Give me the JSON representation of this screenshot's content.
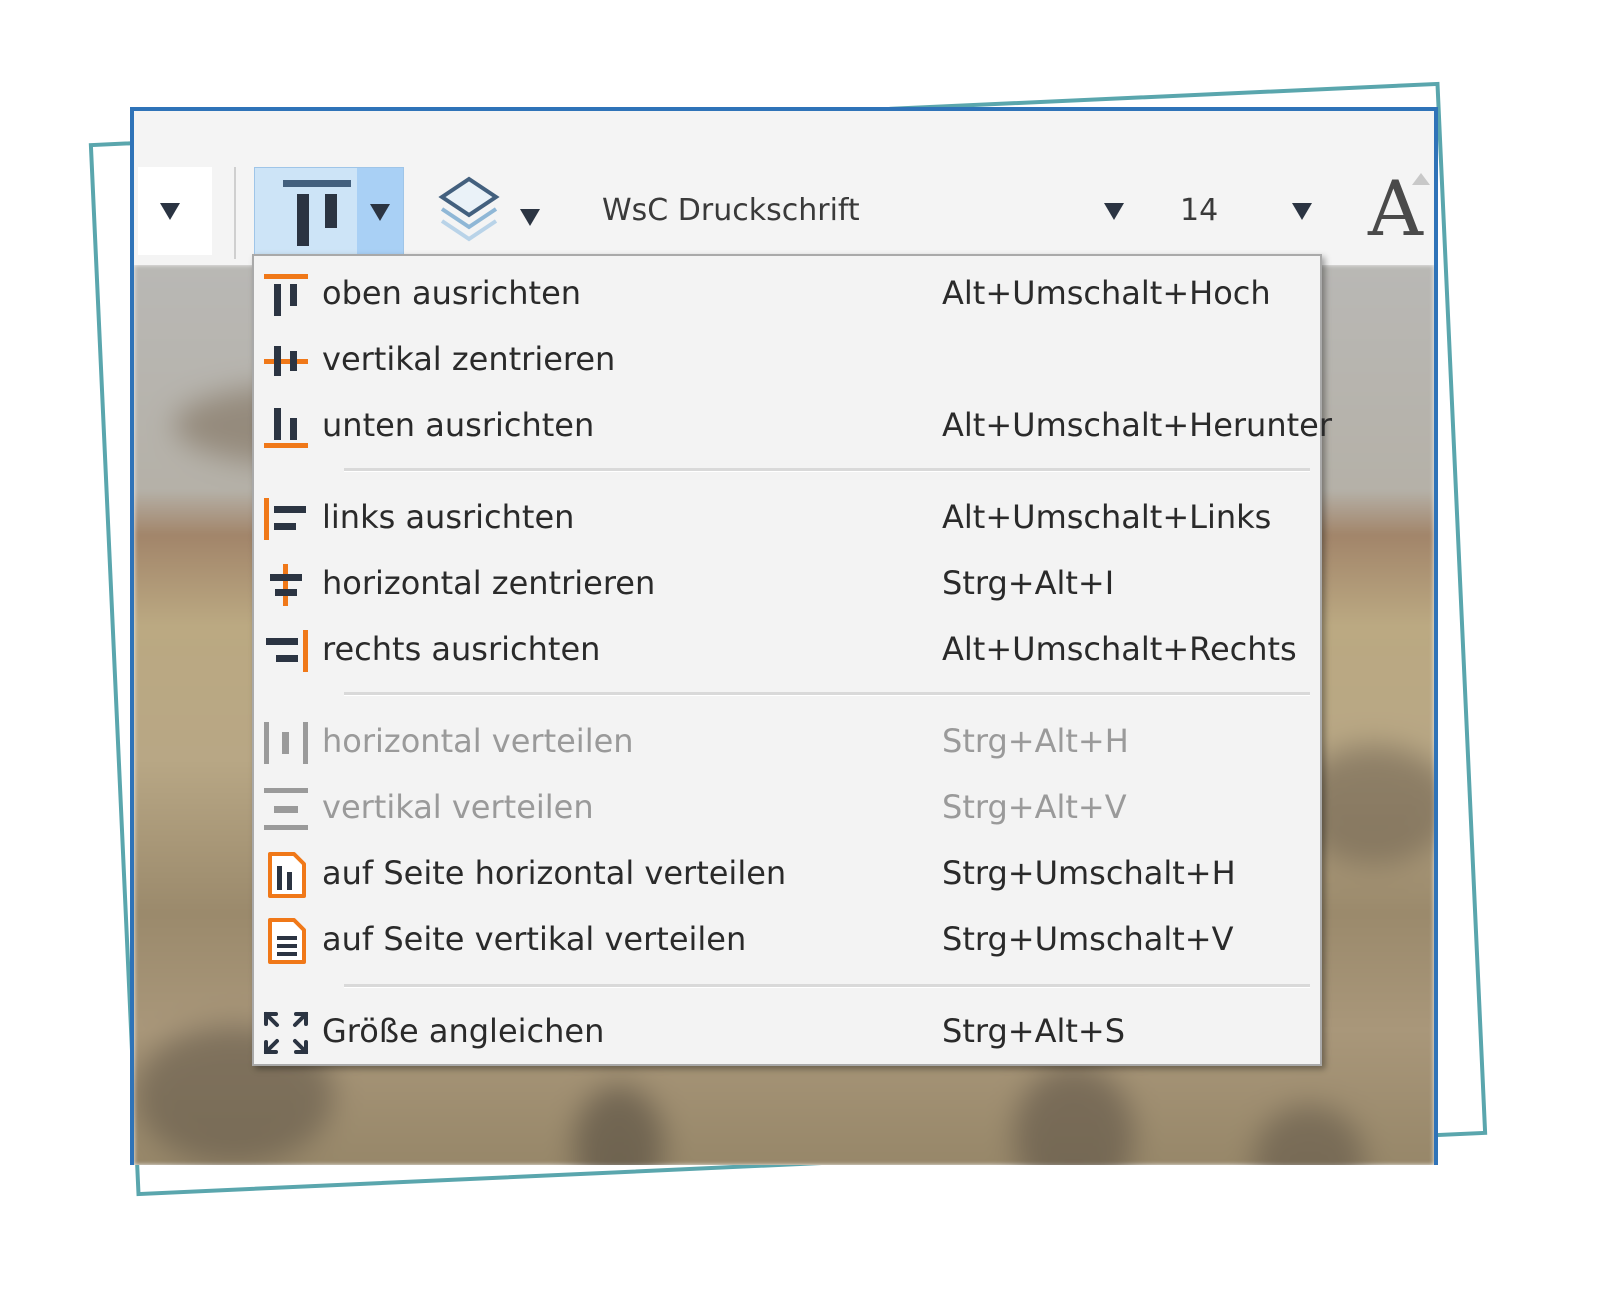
{
  "toolbar": {
    "font_name": "WsC Druckschrift",
    "font_size": "14",
    "font_glyph": "A",
    "icons": [
      "dropdown-arrow-icon",
      "align-top-icon",
      "layers-icon",
      "font-style-icon"
    ]
  },
  "colors": {
    "accent_orange": "#f07818",
    "icon_dark": "#2b3442",
    "frame_teal": "#5aa6ad",
    "window_border": "#2f73b8",
    "split_highlight": "#a9d0f5"
  },
  "menu": {
    "items": [
      {
        "label": "oben ausrichten",
        "shortcut": "Alt+Umschalt+Hoch",
        "enabled": true,
        "icon": "align-top-icon"
      },
      {
        "label": "vertikal zentrieren",
        "shortcut": "",
        "enabled": true,
        "icon": "align-vertical-center-icon"
      },
      {
        "label": "unten ausrichten",
        "shortcut": "Alt+Umschalt+Herunter",
        "enabled": true,
        "icon": "align-bottom-icon"
      },
      {
        "label": "links ausrichten",
        "shortcut": "Alt+Umschalt+Links",
        "enabled": true,
        "icon": "align-left-icon"
      },
      {
        "label": "horizontal zentrieren",
        "shortcut": "Strg+Alt+I",
        "enabled": true,
        "icon": "align-horizontal-center-icon"
      },
      {
        "label": "rechts ausrichten",
        "shortcut": "Alt+Umschalt+Rechts",
        "enabled": true,
        "icon": "align-right-icon"
      },
      {
        "label": "horizontal verteilen",
        "shortcut": "Strg+Alt+H",
        "enabled": false,
        "icon": "distribute-horizontal-icon"
      },
      {
        "label": "vertikal verteilen",
        "shortcut": "Strg+Alt+V",
        "enabled": false,
        "icon": "distribute-vertical-icon"
      },
      {
        "label": "auf Seite horizontal verteilen",
        "shortcut": "Strg+Umschalt+H",
        "enabled": true,
        "icon": "page-distribute-horizontal-icon"
      },
      {
        "label": "auf Seite vertikal verteilen",
        "shortcut": "Strg+Umschalt+V",
        "enabled": true,
        "icon": "page-distribute-vertical-icon"
      },
      {
        "label": "Größe angleichen",
        "shortcut": "Strg+Alt+S",
        "enabled": true,
        "icon": "match-size-icon"
      }
    ]
  }
}
